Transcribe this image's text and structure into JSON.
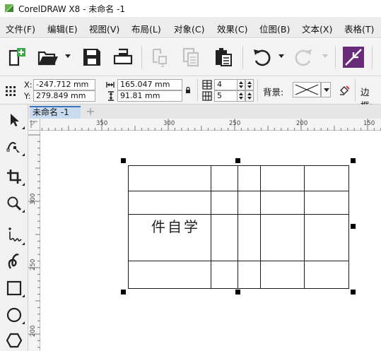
{
  "window": {
    "title": "CorelDRAW X8 - 未命名 -1"
  },
  "menu": {
    "items": [
      {
        "label": "文件(F)"
      },
      {
        "label": "编辑(E)"
      },
      {
        "label": "视图(V)"
      },
      {
        "label": "布局(L)"
      },
      {
        "label": "对象(C)"
      },
      {
        "label": "效果(C)"
      },
      {
        "label": "位图(B)"
      },
      {
        "label": "文本(X)"
      },
      {
        "label": "表格(T)"
      }
    ]
  },
  "toolbar": {
    "icons": [
      "new-document-icon",
      "open-folder-icon",
      "save-icon",
      "print-icon",
      "cut-icon",
      "copy-icon",
      "paste-icon",
      "undo-icon",
      "redo-icon",
      "pick-fit-icon"
    ]
  },
  "propbar": {
    "x_label": "X:",
    "x_value": "-247.712 mm",
    "y_label": "Y:",
    "y_value": "279.849 mm",
    "width_value": "165.047 mm",
    "height_value": "91.81 mm",
    "rows_value": "4",
    "cols_value": "5",
    "background_label": "背景:",
    "border_label": "边框:"
  },
  "document": {
    "tab_label": "未命名 -1",
    "add_tab": "+"
  },
  "rulers": {
    "horizontal": [
      "350",
      "300",
      "250",
      "200",
      "150"
    ],
    "vertical": [
      "300",
      "250",
      "200"
    ]
  },
  "table": {
    "rows": 4,
    "cols": 5,
    "cell_text": "件自学"
  },
  "colors": {
    "accent": "#3a78c3",
    "selection": "#000000"
  }
}
